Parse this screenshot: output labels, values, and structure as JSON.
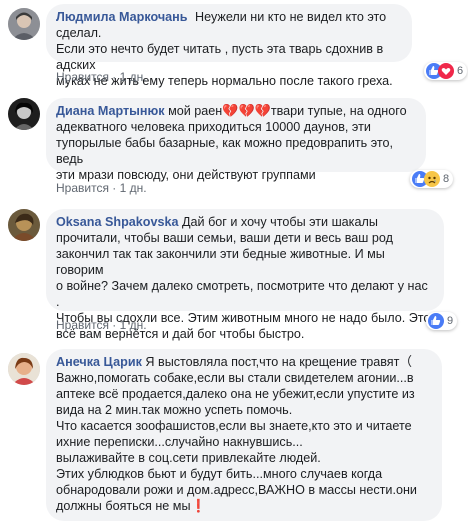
{
  "comments": [
    {
      "name": "Людмила Маркочань",
      "lines": [
        "Неужели ни кто не видел кто это сделал.",
        "Если это нечто будет читать , пусть эта тварь сдохнив в адских",
        "муках не жить ему теперь нормально после такого греха."
      ],
      "like_label": "Нравится",
      "time": "· 1 дн.",
      "reaction_count": "6",
      "reactions": [
        "like-icon",
        "heart-icon"
      ]
    },
    {
      "name": "Диана Мартынюк",
      "first_text": " мой раен",
      "first_text_after": "твари тупые, на одного",
      "lines": [
        "адекватного человека приходиться 10000 даунов, эти",
        "тупорылые бабы базарные, как можно предоврапить это, ведь",
        "эти мрази повсюду, они действуют группами"
      ],
      "like_label": "Нравится",
      "time": "· 1 дн.",
      "reaction_count": "8",
      "reactions": [
        "like-icon",
        "sad-icon"
      ]
    },
    {
      "name": "Oksana Shpakovska",
      "first_text": " Дай бог и хочу чтобы эти шакалы",
      "lines": [
        "прочитали, чтобы ваши семьи, ваши дети и весь ваш род",
        "закончил так так закончили эти бедные животные. И мы говорим",
        "о войне? Зачем далеко смотреть, посмотрите что делают у нас .",
        "Чтобы вы сдохли все. Этим животным много не надо было. Это",
        "всё вам вернётся и дай бог чтобы быстро."
      ],
      "like_label": "Нравится",
      "time": "· 1 дн.",
      "reaction_count": "9",
      "reactions": [
        "like-icon"
      ]
    },
    {
      "name": "Анечка Царик",
      "first_text": " Я выстовляла пост,что на крещение травят（",
      "lines": [
        "Важно,помогать собаке,если вы стали свидетелем агонии...в",
        "аптеке всё продается,далеко она не убежит,если упустите из",
        "вида на 2 мин.так можно успеть помочь.",
        "Что касается зоофашистов,если вы знаете,кто это и читаете",
        "ихние переписки...случайно накнувшись...",
        "вылаживайте в соц.сети привлекайте людей.",
        "Этих ублюдков бьют и будут бить...много случаев когда",
        "обнародовали рожи и дом.адресс,ВАЖНО в массы нести.они",
        "должны бояться не мы❗"
      ]
    }
  ],
  "colors": {
    "name": "#385898",
    "bubble": "#f2f3f5",
    "meta": "#606770"
  }
}
